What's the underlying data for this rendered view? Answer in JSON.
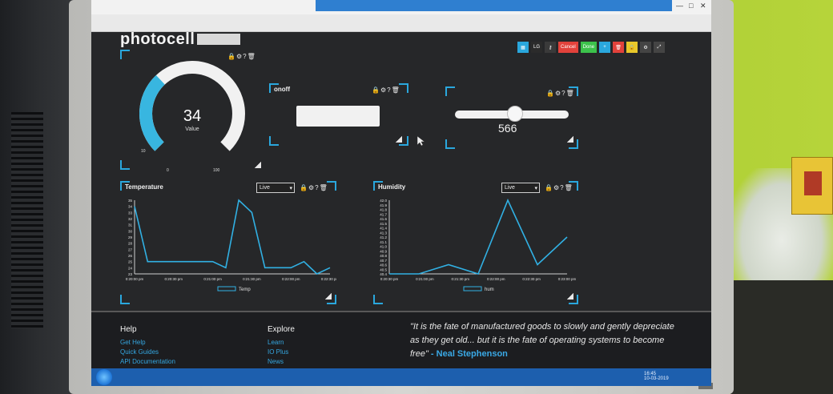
{
  "brand": {
    "name": "photocell"
  },
  "toolbar": {
    "buttons": [
      {
        "label": "",
        "icon": "grid-icon",
        "color": "#2aa7dd"
      },
      {
        "label": "LG",
        "icon": "",
        "color": "#2b2b2b"
      },
      {
        "label": "",
        "icon": "key-icon",
        "color": "#3a3a3a"
      },
      {
        "label": "Cancel",
        "icon": "",
        "color": "#e2423b"
      },
      {
        "label": "Done",
        "icon": "",
        "color": "#3cc24b"
      },
      {
        "label": "",
        "icon": "plus-icon",
        "color": "#2aa7dd"
      },
      {
        "label": "",
        "icon": "trash-icon",
        "color": "#e2423b"
      },
      {
        "label": "",
        "icon": "lock-icon",
        "color": "#e8c72a"
      },
      {
        "label": "",
        "icon": "gear-icon",
        "color": "#444444"
      },
      {
        "label": "",
        "icon": "expand-icon",
        "color": "#444444"
      }
    ]
  },
  "block_controls": "🔒⚙?🗑",
  "gauge": {
    "value": "34",
    "label": "Value",
    "min": "0",
    "max": "100",
    "tick": "10",
    "fraction": 0.34
  },
  "onoff": {
    "title": "onoff"
  },
  "slider": {
    "value": "566",
    "fraction": 0.53
  },
  "charts": {
    "temperature": {
      "title": "Temperature",
      "range": "Live",
      "legend": "Temp"
    },
    "humidity": {
      "title": "Humidity",
      "range": "Live",
      "legend": "hum"
    }
  },
  "chart_data": [
    {
      "type": "line",
      "title": "Temperature",
      "series": [
        {
          "name": "Temp",
          "values": [
            34,
            25,
            25,
            25,
            25,
            25,
            25,
            24,
            35,
            33,
            24,
            24,
            24,
            25,
            23,
            24
          ]
        }
      ],
      "y_ticks": [
        "23",
        "24",
        "25",
        "26",
        "27",
        "28",
        "29",
        "30",
        "31",
        "32",
        "33",
        "34",
        "35"
      ],
      "x_ticks": [
        "0:20:00 pm",
        "0:20:30 pm",
        "0:21:00 pm",
        "0:21:30 pm",
        "0:22:00 pm",
        "0:22:30 pm"
      ],
      "ylim": [
        23,
        35
      ],
      "legend": "bottom"
    },
    {
      "type": "line",
      "title": "Humidity",
      "series": [
        {
          "name": "hum",
          "values": [
            40.4,
            40.4,
            40.6,
            40.4,
            42,
            40.6,
            41.2
          ]
        }
      ],
      "y_ticks": [
        "40.4",
        "40.5",
        "40.6",
        "40.7",
        "40.8",
        "40.9",
        "41.0",
        "41.1",
        "41.2",
        "41.3",
        "41.4",
        "41.5",
        "41.6",
        "41.7",
        "41.8",
        "41.9",
        "42.0"
      ],
      "x_ticks": [
        "0:20:30 pm",
        "0:21:00 pm",
        "0:21:30 pm",
        "0:22:00 pm",
        "0:22:30 pm",
        "0:23:00 pm"
      ],
      "ylim": [
        40.4,
        42
      ],
      "legend": "bottom"
    }
  ],
  "footer": {
    "help": {
      "heading": "Help",
      "links": [
        "Get Help",
        "Quick Guides",
        "API Documentation"
      ]
    },
    "explore": {
      "heading": "Explore",
      "links": [
        "Learn",
        "IO Plus",
        "News"
      ]
    },
    "quote": "\"It is the fate of manufactured goods to slowly and gently depreciate as they get old... but it is the fate of operating systems to become free\"",
    "author": "- Neal Stephenson"
  },
  "taskbar": {
    "clock": "16:45",
    "date": "10-03-2019"
  }
}
